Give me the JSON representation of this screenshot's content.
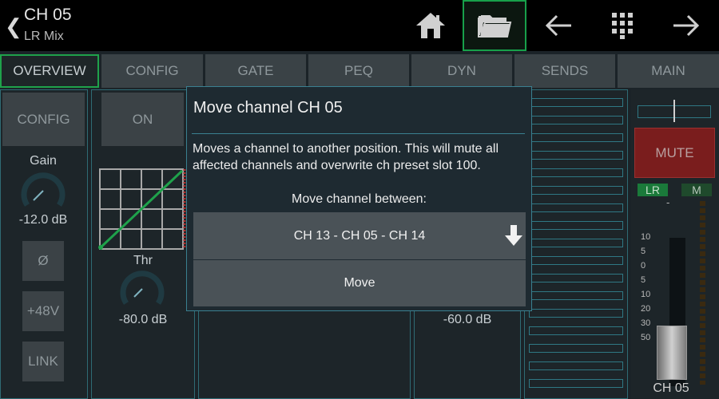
{
  "header": {
    "channel": "CH 05",
    "bus": "LR Mix"
  },
  "toolbar": {
    "home_icon": "home-icon",
    "folder_icon": "folder-icon",
    "prev_icon": "arrow-left-icon",
    "grid_icon": "grid-icon",
    "next_icon": "arrow-right-icon"
  },
  "tabs": [
    "OVERVIEW",
    "CONFIG",
    "GATE",
    "PEQ",
    "DYN",
    "SENDS",
    "MAIN"
  ],
  "config_strip": {
    "config_label": "CONFIG",
    "gain_label": "Gain",
    "gain_value": "-12.0 dB",
    "phase_label": "Ø",
    "phantom_label": "+48V",
    "link_label": "LINK"
  },
  "gate_strip": {
    "on_label": "ON",
    "thr_label": "Thr",
    "thr_value": "-80.0 dB"
  },
  "dyn_strip": {
    "value": "-60.0 dB"
  },
  "main_strip": {
    "mute_label": "MUTE",
    "lr_label": "LR",
    "m_label": "M",
    "dash": "-",
    "scale": [
      "10",
      "5",
      "0",
      "5",
      "10",
      "20",
      "30",
      "50"
    ],
    "channel_label": "CH 05"
  },
  "dialog": {
    "title": "Move channel CH 05",
    "description": "Moves a channel to another position. This will mute all affected channels and overwrite ch preset slot 100.",
    "subtitle": "Move channel between:",
    "selection": "CH 13 - CH 05 - CH 14",
    "move_label": "Move"
  },
  "colors": {
    "accent_green": "#1fa24b",
    "mute_red": "#7a1d1d",
    "teal_border": "#2f7884"
  }
}
